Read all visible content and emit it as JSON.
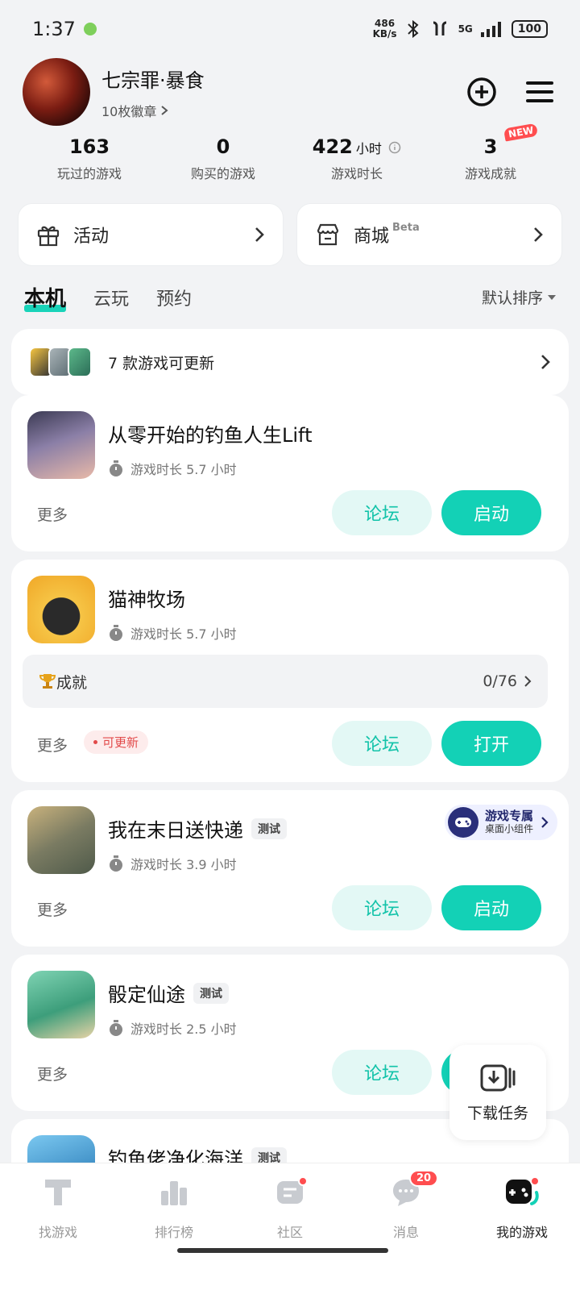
{
  "status": {
    "time": "1:37",
    "speed_top": "486",
    "speed_bottom": "KB/s",
    "network": "5G",
    "battery": "100"
  },
  "profile": {
    "name": "七宗罪·暴食",
    "badges": "10枚徽章"
  },
  "stats": [
    {
      "value": "163",
      "label": "玩过的游戏"
    },
    {
      "value": "0",
      "label": "购买的游戏"
    },
    {
      "value": "422",
      "unit": "小时",
      "label": "游戏时长"
    },
    {
      "value": "3",
      "label": "游戏成就",
      "badge": "NEW"
    }
  ],
  "quick": {
    "activity": "活动",
    "store": "商城",
    "store_tag": "Beta"
  },
  "tabs": [
    "本机",
    "云玩",
    "预约"
  ],
  "sort_label": "默认排序",
  "update_banner": "7 款游戏可更新",
  "common": {
    "more": "更多",
    "forum": "论坛",
    "launch": "启动",
    "open": "打开",
    "can_update": "可更新",
    "test_tag": "测试"
  },
  "games": [
    {
      "title": "从零开始的钓鱼人生Lift",
      "playtime": "游戏时长 5.7 小时"
    },
    {
      "title": "猫神牧场",
      "playtime": "游戏时长 5.7 小时",
      "achievement_label": "成就",
      "achievement_count": "0/76"
    },
    {
      "title": "我在末日送快递",
      "playtime": "游戏时长 3.9 小时",
      "widget_title": "游戏专属",
      "widget_sub": "桌面小组件"
    },
    {
      "title": "骰定仙途",
      "playtime": "游戏时长 2.5 小时"
    },
    {
      "title": "钓鱼佬净化海洋"
    }
  ],
  "download_task": "下载任务",
  "nav": [
    {
      "label": "找游戏"
    },
    {
      "label": "排行榜"
    },
    {
      "label": "社区"
    },
    {
      "label": "消息",
      "badge": "20"
    },
    {
      "label": "我的游戏"
    }
  ],
  "colors": {
    "accent": "#13d1b6",
    "accent_light": "#e3f8f5",
    "alert": "#ff4d4f",
    "background": "#f2f3f5"
  }
}
